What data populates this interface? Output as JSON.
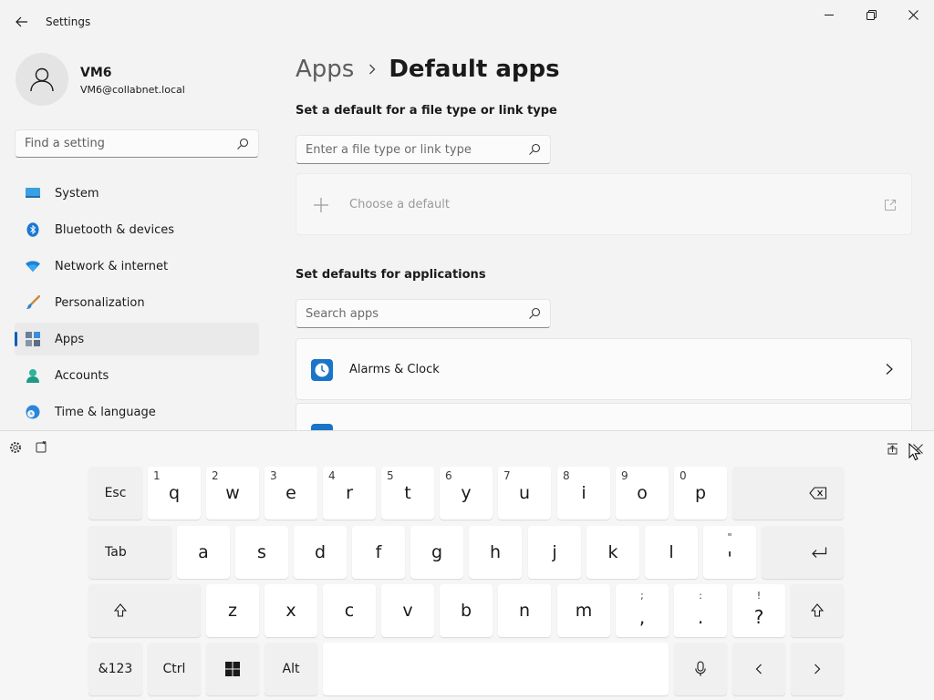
{
  "window": {
    "title": "Settings"
  },
  "user": {
    "name": "VM6",
    "email": "VM6@collabnet.local"
  },
  "sidebar": {
    "search_placeholder": "Find a setting",
    "items": [
      {
        "label": "System",
        "icon": "monitor-icon"
      },
      {
        "label": "Bluetooth & devices",
        "icon": "bluetooth-icon"
      },
      {
        "label": "Network & internet",
        "icon": "wifi-icon"
      },
      {
        "label": "Personalization",
        "icon": "brush-icon"
      },
      {
        "label": "Apps",
        "icon": "apps-icon",
        "active": true
      },
      {
        "label": "Accounts",
        "icon": "person-icon"
      },
      {
        "label": "Time & language",
        "icon": "globe-clock-icon"
      }
    ]
  },
  "main": {
    "breadcrumb": {
      "parent": "Apps",
      "current": "Default apps"
    },
    "file_type_section": {
      "title": "Set a default for a file type or link type",
      "placeholder": "Enter a file type or link type",
      "choose_label": "Choose a default"
    },
    "apps_section": {
      "title": "Set defaults for applications",
      "placeholder": "Search apps",
      "apps": [
        {
          "label": "Alarms & Clock",
          "icon": "clock-icon"
        }
      ]
    }
  },
  "keyboard": {
    "row1": [
      {
        "main": "Esc"
      },
      {
        "main": "q",
        "hint": "1"
      },
      {
        "main": "w",
        "hint": "2"
      },
      {
        "main": "e",
        "hint": "3"
      },
      {
        "main": "r",
        "hint": "4"
      },
      {
        "main": "t",
        "hint": "5"
      },
      {
        "main": "y",
        "hint": "6"
      },
      {
        "main": "u",
        "hint": "7"
      },
      {
        "main": "i",
        "hint": "8"
      },
      {
        "main": "o",
        "hint": "9"
      },
      {
        "main": "p",
        "hint": "0"
      }
    ],
    "row2": [
      {
        "main": "Tab"
      },
      {
        "main": "a"
      },
      {
        "main": "s"
      },
      {
        "main": "d"
      },
      {
        "main": "f"
      },
      {
        "main": "g"
      },
      {
        "main": "h"
      },
      {
        "main": "j"
      },
      {
        "main": "k"
      },
      {
        "main": "l"
      },
      {
        "main": "'",
        "top": "\""
      }
    ],
    "row3": [
      {
        "main": "z"
      },
      {
        "main": "x"
      },
      {
        "main": "c"
      },
      {
        "main": "v"
      },
      {
        "main": "b"
      },
      {
        "main": "n"
      },
      {
        "main": "m"
      },
      {
        "main": ",",
        "top": ";"
      },
      {
        "main": ".",
        "top": ":"
      },
      {
        "main": "?",
        "top": "!"
      }
    ],
    "row4": {
      "symbols": "&123",
      "ctrl": "Ctrl",
      "alt": "Alt"
    }
  },
  "colors": {
    "accent": "#005fb8",
    "background": "#f3f3f3"
  }
}
